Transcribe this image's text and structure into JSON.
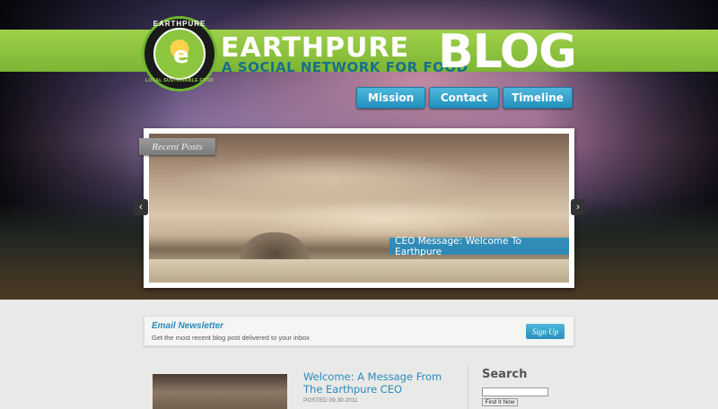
{
  "header": {
    "title": "EARTHPURE",
    "subtitle": "A SOCIAL NETWORK FOR FOOD",
    "blog_word": "BLOG",
    "logo": {
      "top_text": "EARTHPURE",
      "bottom_text": "LOCAL SUSTAINABLE FOOD",
      "letter": "e"
    }
  },
  "nav": {
    "items": [
      {
        "label": "Mission"
      },
      {
        "label": "Contact"
      },
      {
        "label": "Timeline"
      }
    ]
  },
  "slider": {
    "tab_label": "Recent Posts",
    "caption": "CEO Message: Welcome To Earthpure",
    "prev_icon": "chevron-left-icon",
    "next_icon": "chevron-right-icon"
  },
  "newsletter": {
    "title": "Email Newsletter",
    "description": "Get the most recent blog post delivered to your inbox",
    "button_label": "Sign Up"
  },
  "post": {
    "title": "Welcome: A Message From The Earthpure CEO",
    "date": "POSTED 09.30.2011"
  },
  "sidebar": {
    "search_heading": "Search",
    "search_value": "",
    "search_button": "Find It Now"
  },
  "colors": {
    "brand_green": "#8cc63f",
    "accent_blue": "#2a8bbd"
  }
}
